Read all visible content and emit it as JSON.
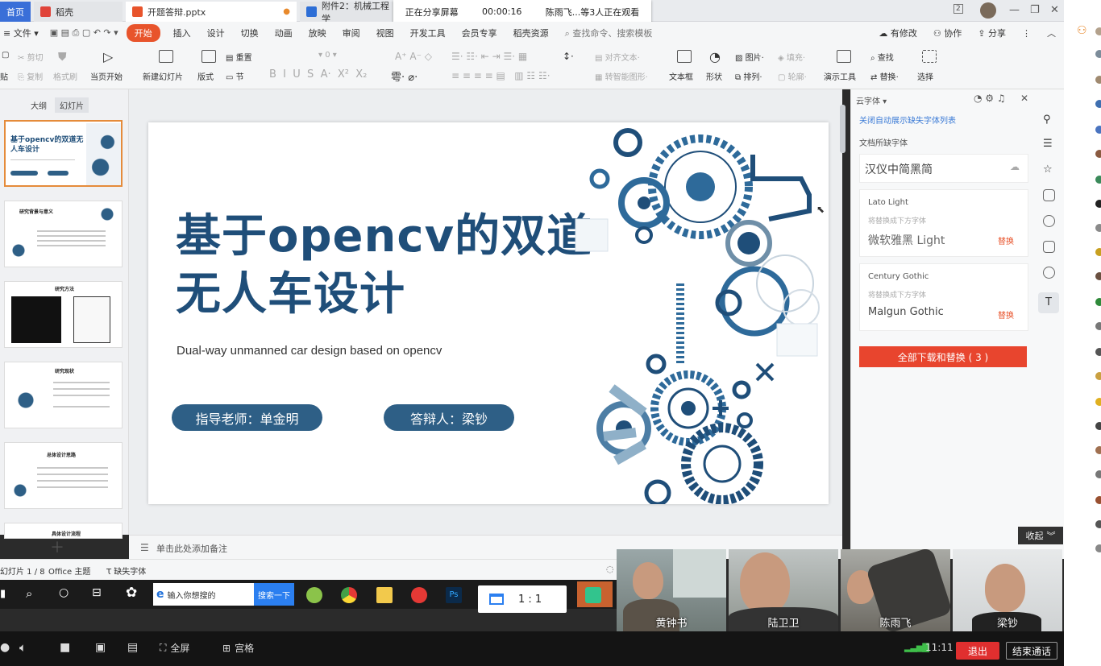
{
  "tabs": [
    {
      "label": "首页"
    },
    {
      "label": "稻壳"
    },
    {
      "label": "开题答辩.pptx"
    },
    {
      "label": "附件2：机械工程学"
    }
  ],
  "share": {
    "status": "正在分享屏幕",
    "time": "00:00:16",
    "viewers": "陈雨飞...等3人正在观看"
  },
  "menu": {
    "file": "文件",
    "items": [
      "开始",
      "插入",
      "设计",
      "切换",
      "动画",
      "放映",
      "审阅",
      "视图",
      "开发工具",
      "会员专享",
      "稻壳资源"
    ],
    "search": "查找命令、搜索模板",
    "right": [
      "有修改",
      "协作",
      "分享"
    ]
  },
  "ribbon": {
    "cut": "剪切",
    "copy": "复制",
    "format_painter": "格式刷",
    "paste": "贴",
    "from_current": "当页开始",
    "new_slide": "新建幻灯片",
    "layout": "版式",
    "section": "节",
    "reset": "重置",
    "font_size": "0",
    "to_smartart": "转智能图形",
    "text_box": "文本框",
    "shapes": "形状",
    "arrange": "排列",
    "picture": "图片",
    "fill": "填充",
    "outline": "轮廓",
    "presenter": "演示工具",
    "find": "查找",
    "replace": "替换",
    "select": "选择"
  },
  "left_panel": {
    "tabs": [
      "大纲",
      "幻灯片"
    ],
    "thumbs": [
      {
        "title": "基于opencv的双道无人车设计"
      },
      {
        "title": "研究背景与意义"
      },
      {
        "title": "研究方法"
      },
      {
        "title": "研究现状"
      },
      {
        "title": "总体设计思路"
      },
      {
        "title": "具体设计流程"
      }
    ]
  },
  "slide": {
    "title_line1": "基于opencv的双道",
    "title_line2": "无人车设计",
    "subtitle": "Dual-way unmanned car design based on opencv",
    "advisor": "指导老师：单金明",
    "defender": "答辩人：梁钞"
  },
  "notes": {
    "placeholder": "单击此处添加备注"
  },
  "status": {
    "slide": "幻灯片 1 / 8",
    "theme": "Office 主题",
    "missing_font": "缺失字体"
  },
  "font_panel": {
    "title": "云字体",
    "toggle": "关闭自动展示缺失字体列表",
    "section": "文档所缺字体",
    "cards": [
      {
        "name": "汉仪中简黑简"
      },
      {
        "name": "Lato Light",
        "hint": "将替换成下方字体",
        "replace": "微软雅黑 Light",
        "action": "替换"
      },
      {
        "name": "Century Gothic",
        "hint": "将替换成下方字体",
        "replace": "Malgun Gothic",
        "action": "替换"
      }
    ],
    "download_all": "全部下载和替换 ( 3 )"
  },
  "taskbar": {
    "search_placeholder": "输入你想搜的",
    "search_btn": "搜索一下",
    "zoom": "1 : 1"
  },
  "participants": [
    {
      "name": "黄钟书"
    },
    {
      "name": "陆卫卫"
    },
    {
      "name": "陈雨飞"
    },
    {
      "name": "梁钞"
    }
  ],
  "meeting": {
    "collapse": "收起",
    "fullscreen": "全屏",
    "grid": "宫格",
    "time": "11:11",
    "exit": "退出",
    "end": "结束通话"
  },
  "colors": {
    "accent": "#e8542c",
    "slide_blue": "#1f4e79",
    "pill_blue": "#2e5f86",
    "exit_red": "#e02f2f"
  }
}
